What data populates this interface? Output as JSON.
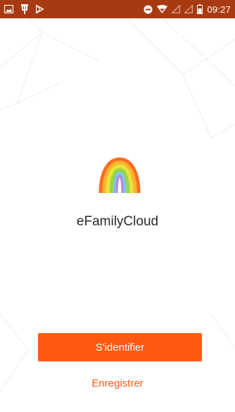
{
  "status_bar": {
    "time": "09:27",
    "background_color": "#a83a12",
    "left_icons": [
      "image-icon",
      "usb-icon",
      "play-store-icon"
    ],
    "right_icons": [
      "do-not-disturb-icon",
      "wifi-icon",
      "signal-icon",
      "signal-icon",
      "battery-icon"
    ]
  },
  "app": {
    "name": "eFamilyCloud",
    "logo_icon": "rainbow-logo-icon"
  },
  "actions": {
    "login_label": "S'identifier",
    "register_label": "Enregistrer",
    "accent_color": "#ff5a0f"
  }
}
